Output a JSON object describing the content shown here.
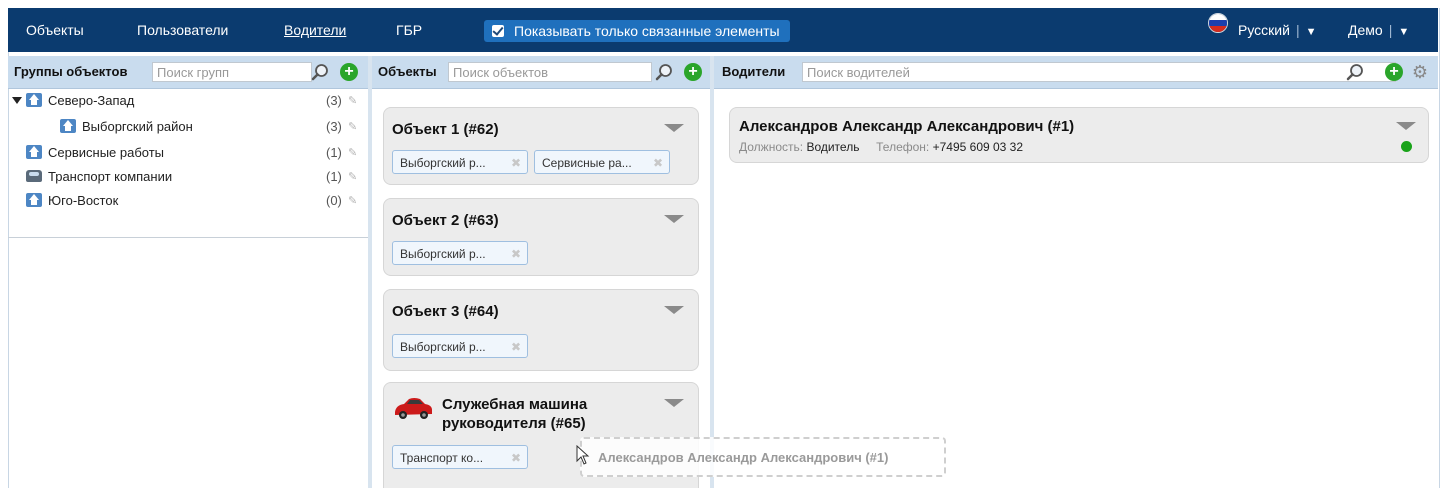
{
  "nav": {
    "items": [
      {
        "label": "Объекты",
        "active": false
      },
      {
        "label": "Пользователи",
        "active": false
      },
      {
        "label": "Водители",
        "active": true
      },
      {
        "label": "ГБР",
        "active": false
      }
    ],
    "toggle_label": "Показывать только связанные элементы",
    "toggle_checked": true,
    "language": "Русский",
    "user": "Демо",
    "separator": "|",
    "arrow": "▼"
  },
  "groups_panel": {
    "title": "Группы объектов",
    "search_placeholder": "Поиск групп",
    "tree": [
      {
        "label": "Северо-Запад",
        "count": "(3)",
        "icon": "house-icon",
        "expanded": true,
        "level": 0
      },
      {
        "label": "Выборгский район",
        "count": "(3)",
        "icon": "house-icon",
        "level": 1
      },
      {
        "label": "Сервисные работы",
        "count": "(1)",
        "icon": "house-icon",
        "level": 0
      },
      {
        "label": "Транспорт компании",
        "count": "(1)",
        "icon": "car-icon",
        "level": 0
      },
      {
        "label": "Юго-Восток",
        "count": "(0)",
        "icon": "house-icon",
        "level": 0
      }
    ]
  },
  "objects_panel": {
    "title": "Объекты",
    "search_placeholder": "Поиск объектов",
    "cards": [
      {
        "title": "Объект 1 (#62)",
        "tags": [
          "Выборгский р...",
          "Сервисные ра..."
        ]
      },
      {
        "title": "Объект 2 (#63)",
        "tags": [
          "Выборгский р..."
        ]
      },
      {
        "title": "Объект 3 (#64)",
        "tags": [
          "Выборгский р..."
        ]
      },
      {
        "title_line1": "Служебная машина",
        "title_line2": "руководителя (#65)",
        "icon": "red-car-icon",
        "tags": [
          "Транспорт ко..."
        ]
      }
    ],
    "tag_remove_glyph": "✖"
  },
  "drivers_panel": {
    "title": "Водители",
    "search_placeholder": "Поиск водителей",
    "drivers": [
      {
        "name": "Александров Александр Александрович (#1)",
        "position_label": "Должность:",
        "position": "Водитель",
        "phone_label": "Телефон:",
        "phone": "+7495 609 03 32",
        "status_color": "#19a319"
      }
    ]
  },
  "drag_ghost": {
    "text": "Александров Александр Александрович (#1)"
  },
  "colors": {
    "topbar": "#0b3b6f",
    "toggle": "#1f70bd",
    "panel_header": "#c9dcee",
    "add": "#2aa52a",
    "online": "#19a319"
  }
}
